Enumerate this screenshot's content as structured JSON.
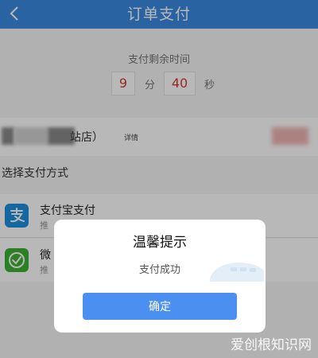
{
  "header": {
    "title": "订单支付"
  },
  "countdown": {
    "label": "支付剩余时间",
    "minutes": "9",
    "minute_unit": "分",
    "seconds": "40",
    "second_unit": "秒"
  },
  "order": {
    "shop_suffix": "站店）",
    "detail_label": "详情"
  },
  "payment": {
    "section_title": "选择支付方式",
    "options": [
      {
        "name": "支付宝支付",
        "sub": "推"
      },
      {
        "name": "微",
        "sub": "推"
      }
    ]
  },
  "dialog": {
    "title": "温馨提示",
    "message": "支付成功",
    "confirm_label": "确定"
  },
  "watermark": {
    "text": "爱创根知识网"
  },
  "colors": {
    "header_bg": "#3b89e0",
    "timer_digit": "#d03b2f",
    "confirm_bg": "#4b8ff0",
    "alipay": "#1e8fe1",
    "wechat": "#3cb034"
  }
}
